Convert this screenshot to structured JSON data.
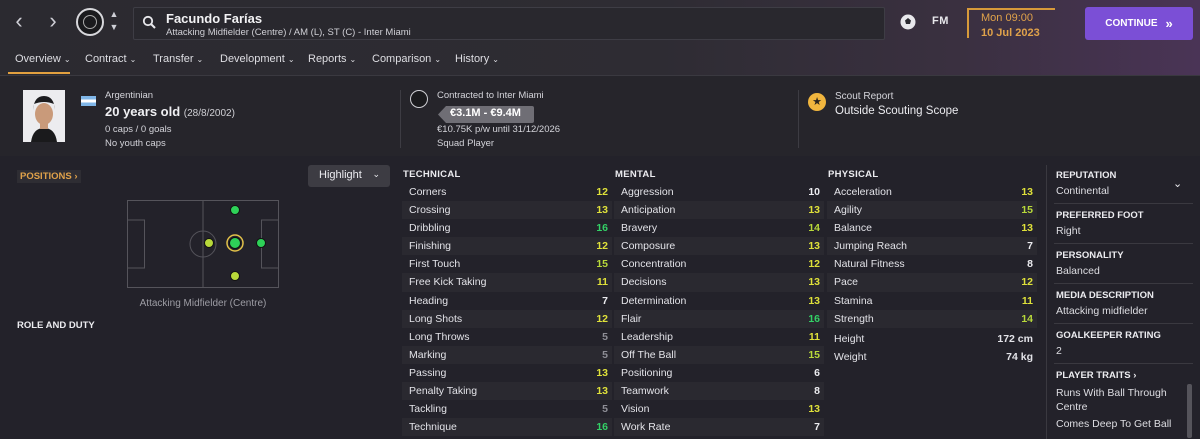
{
  "topbar": {
    "back_icon": "chevron-left",
    "forward_icon": "chevron-right",
    "player_name": "Facundo Farías",
    "player_subtitle": "Attacking Midfielder (Centre) / AM (L), ST (C) - Inter Miami",
    "fm_logo": "FM",
    "date_day": "Mon 09:00",
    "date_date": "10 Jul 2023",
    "continue_label": "CONTINUE",
    "accent_color": "#7b4fd6",
    "date_color": "#e0a24a"
  },
  "tabs": [
    {
      "label": "Overview",
      "active": true
    },
    {
      "label": "Contract"
    },
    {
      "label": "Transfer"
    },
    {
      "label": "Development"
    },
    {
      "label": "Reports"
    },
    {
      "label": "Comparison"
    },
    {
      "label": "History"
    }
  ],
  "header": {
    "nationality": "Argentinian",
    "age": "20 years old",
    "dob": "(28/8/2002)",
    "caps": "0 caps / 0 goals",
    "youth_caps": "No youth caps",
    "contract_title": "Contracted to Inter Miami",
    "value_range": "€3.1M - €9.4M",
    "wage": "€10.75K p/w until 31/12/2026",
    "squad_status": "Squad Player",
    "scout_title": "Scout Report",
    "scout_scope": "Outside Scouting Scope"
  },
  "positions": {
    "link": "POSITIONS",
    "highlight": "Highlight",
    "caption": "Attacking Midfielder (Centre)",
    "role_duty": "ROLE AND DUTY"
  },
  "attributes": {
    "technical_title": "TECHNICAL",
    "mental_title": "MENTAL",
    "physical_title": "PHYSICAL",
    "technical": [
      {
        "name": "Corners",
        "value": 12
      },
      {
        "name": "Crossing",
        "value": 13
      },
      {
        "name": "Dribbling",
        "value": 16
      },
      {
        "name": "Finishing",
        "value": 12
      },
      {
        "name": "First Touch",
        "value": 15
      },
      {
        "name": "Free Kick Taking",
        "value": 11
      },
      {
        "name": "Heading",
        "value": 7
      },
      {
        "name": "Long Shots",
        "value": 12
      },
      {
        "name": "Long Throws",
        "value": 5
      },
      {
        "name": "Marking",
        "value": 5
      },
      {
        "name": "Passing",
        "value": 13
      },
      {
        "name": "Penalty Taking",
        "value": 13
      },
      {
        "name": "Tackling",
        "value": 5
      },
      {
        "name": "Technique",
        "value": 16
      }
    ],
    "mental": [
      {
        "name": "Aggression",
        "value": 10
      },
      {
        "name": "Anticipation",
        "value": 13
      },
      {
        "name": "Bravery",
        "value": 14
      },
      {
        "name": "Composure",
        "value": 13
      },
      {
        "name": "Concentration",
        "value": 12
      },
      {
        "name": "Decisions",
        "value": 13
      },
      {
        "name": "Determination",
        "value": 13
      },
      {
        "name": "Flair",
        "value": 16
      },
      {
        "name": "Leadership",
        "value": 11
      },
      {
        "name": "Off The Ball",
        "value": 15
      },
      {
        "name": "Positioning",
        "value": 6
      },
      {
        "name": "Teamwork",
        "value": 8
      },
      {
        "name": "Vision",
        "value": 13
      },
      {
        "name": "Work Rate",
        "value": 7
      }
    ],
    "physical": [
      {
        "name": "Acceleration",
        "value": 13
      },
      {
        "name": "Agility",
        "value": 15
      },
      {
        "name": "Balance",
        "value": 13
      },
      {
        "name": "Jumping Reach",
        "value": 7
      },
      {
        "name": "Natural Fitness",
        "value": 8
      },
      {
        "name": "Pace",
        "value": 12
      },
      {
        "name": "Stamina",
        "value": 11
      },
      {
        "name": "Strength",
        "value": 14
      }
    ],
    "height_label": "Height",
    "height_value": "172 cm",
    "weight_label": "Weight",
    "weight_value": "74 kg"
  },
  "side_panel": {
    "reputation_label": "REPUTATION",
    "reputation_value": "Continental",
    "foot_label": "PREFERRED FOOT",
    "foot_value": "Right",
    "personality_label": "PERSONALITY",
    "personality_value": "Balanced",
    "media_label": "MEDIA DESCRIPTION",
    "media_value": "Attacking midfielder",
    "gk_label": "GOALKEEPER RATING",
    "gk_value": "2",
    "traits_label": "PLAYER TRAITS",
    "traits": [
      "Runs With Ball Through",
      "Centre",
      "Comes Deep To Get Ball"
    ]
  }
}
